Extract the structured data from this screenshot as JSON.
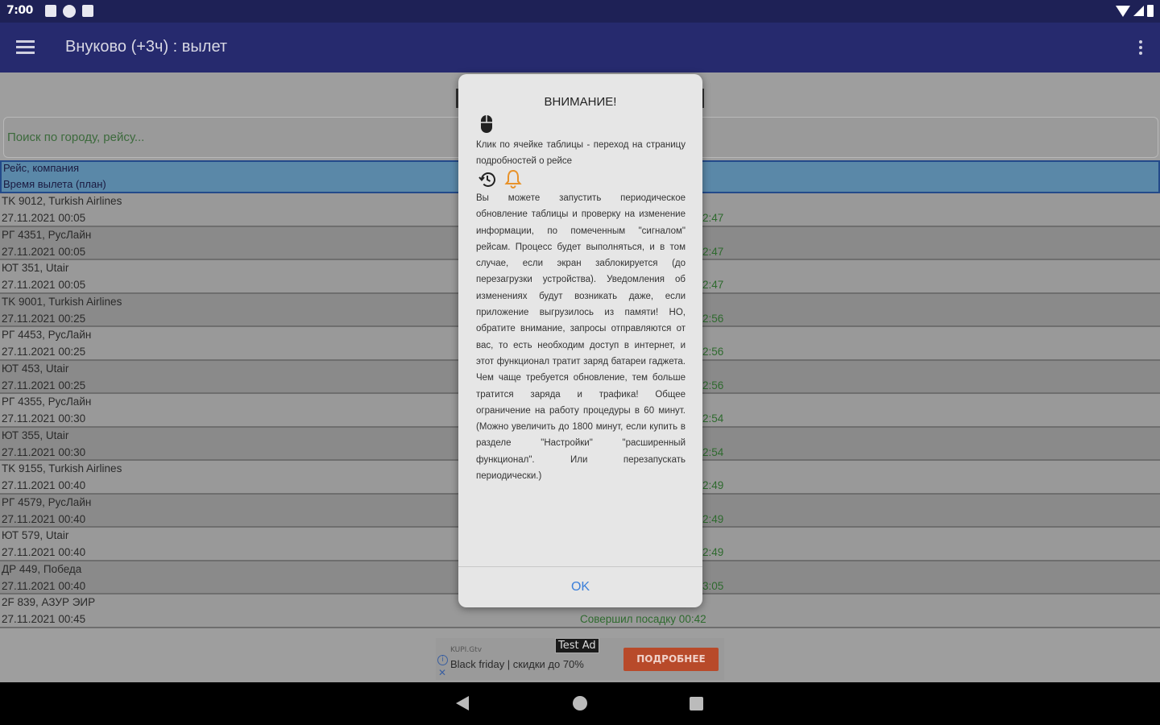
{
  "status": {
    "time": "7:00"
  },
  "appbar": {
    "title": "Внуково (+3ч) : вылет"
  },
  "search": {
    "placeholder": "Поиск по городу, рейсу..."
  },
  "table": {
    "header_line1": "Рейс, компания",
    "header_line2": "Время вылета (план)",
    "rows": [
      {
        "flight": "TK 9012, Turkish Airlines",
        "time": "27.11.2021 00:05",
        "status": "2:47"
      },
      {
        "flight": "РГ 4351, РусЛайн",
        "time": "27.11.2021 00:05",
        "status": "2:47"
      },
      {
        "flight": "ЮТ 351, Utair",
        "time": "27.11.2021 00:05",
        "status": "2:47"
      },
      {
        "flight": "TK 9001, Turkish Airlines",
        "time": "27.11.2021 00:25",
        "status": "2:56"
      },
      {
        "flight": "РГ 4453, РусЛайн",
        "time": "27.11.2021 00:25",
        "status": "2:56"
      },
      {
        "flight": "ЮТ 453, Utair",
        "time": "27.11.2021 00:25",
        "status": "2:56"
      },
      {
        "flight": "РГ 4355, РусЛайн",
        "time": "27.11.2021 00:30",
        "status": "2:54"
      },
      {
        "flight": "ЮТ 355, Utair",
        "time": "27.11.2021 00:30",
        "status": "2:54"
      },
      {
        "flight": "TK 9155, Turkish Airlines",
        "time": "27.11.2021 00:40",
        "status": "2:49"
      },
      {
        "flight": "РГ 4579, РусЛайн",
        "time": "27.11.2021 00:40",
        "status": "2:49"
      },
      {
        "flight": "ЮТ 579, Utair",
        "time": "27.11.2021 00:40",
        "status": "2:49"
      },
      {
        "flight": "ДР 449, Победа",
        "time": "27.11.2021 00:40",
        "status": "3:05"
      },
      {
        "flight": "2F 839, АЗУР ЭИР",
        "time": "27.11.2021 00:45",
        "status_wide": "Совершил посадку 00:42"
      }
    ]
  },
  "ad": {
    "site": "KUPI.Gtv",
    "text": "Black friday | скидки до 70%",
    "badge": "Test Ad",
    "button": "ПОДРОБНЕЕ"
  },
  "dialog": {
    "title": "ВНИМАНИЕ!",
    "text1": "Клик по ячейке таблицы - переход на страницу подробностей о рейсе",
    "text2": "Вы можете запустить периодическое обновление таблицы и проверку на изменение информации, по помеченным \"сигналом\" рейсам. Процесс будет выполняться, и в том случае, если экран заблокируется (до перезагрузки устройства). Уведомления об изменениях будут возникать даже, если приложение выгрузилось из памяти! НО, обратите внимание, запросы отправляются от вас, то есть необходим доступ в интернет, и этот функционал тратит заряд батареи гаджета. Чем чаще требуется обновление, тем больше тратится заряда и трафика! Общее ограничение на работу процедуры в 60 минут. (Можно увеличить до 1800 минут, если купить в разделе \"Настройки\" \"расширенный функционал\". Или перезапускать периодически.)",
    "ok": "OK"
  },
  "colors": {
    "appbar": "#262a6e",
    "accent": "#3b7fd9",
    "bell": "#e8922a"
  }
}
